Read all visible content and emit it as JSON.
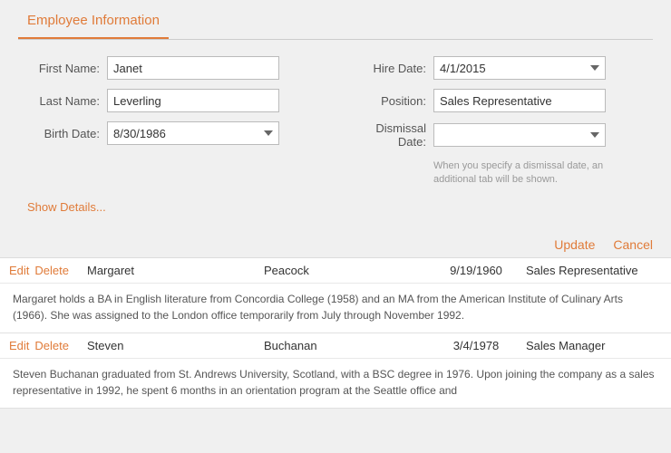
{
  "tab": {
    "label": "Employee Information"
  },
  "form": {
    "first_name_label": "First Name:",
    "first_name_value": "Janet",
    "last_name_label": "Last Name:",
    "last_name_value": "Leverling",
    "birth_date_label": "Birth Date:",
    "birth_date_value": "8/30/1986",
    "hire_date_label": "Hire Date:",
    "hire_date_value": "4/1/2015",
    "position_label": "Position:",
    "position_value": "Sales Representative",
    "dismissal_date_label": "Dismissal Date:",
    "dismissal_date_value": "",
    "dismissal_hint": "When you specify a dismissal date, an additional tab will be shown.",
    "show_details_label": "Show Details..."
  },
  "actions": {
    "update_label": "Update",
    "cancel_label": "Cancel"
  },
  "employees": [
    {
      "first_name": "Margaret",
      "last_name": "Peacock",
      "birth_date": "9/19/1960",
      "position": "Sales Representative",
      "description": "Margaret holds a BA in English literature from Concordia College (1958) and an MA from the American Institute of Culinary Arts (1966). She was assigned to the London office temporarily from July through November 1992."
    },
    {
      "first_name": "Steven",
      "last_name": "Buchanan",
      "birth_date": "3/4/1978",
      "position": "Sales Manager",
      "description": "Steven Buchanan graduated from St. Andrews University, Scotland, with a BSC degree in 1976. Upon joining the company as a sales representative in 1992, he spent 6 months in an orientation program at the Seattle office and"
    }
  ],
  "icons": {
    "dropdown_arrow": "▾",
    "edit_label": "Edit",
    "delete_label": "Delete"
  }
}
